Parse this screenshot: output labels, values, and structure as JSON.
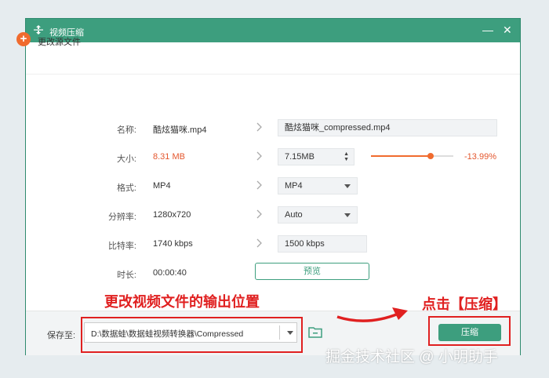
{
  "titlebar": {
    "title": "视频压缩",
    "minimize": "—",
    "close": "✕"
  },
  "toolbar": {
    "change_source_label": "更改源文件"
  },
  "labels": {
    "name": "名称:",
    "size": "大小:",
    "format": "格式:",
    "resolution": "分辨率:",
    "bitrate": "比特率:",
    "duration": "时长:"
  },
  "source": {
    "name": "酷炫猫咪.mp4",
    "size": "8.31 MB",
    "format": "MP4",
    "resolution": "1280x720",
    "bitrate": "1740 kbps",
    "duration": "00:00:40"
  },
  "output": {
    "name": "酷炫猫咪_compressed.mp4",
    "size": "7.15MB",
    "format": "MP4",
    "resolution": "Auto",
    "bitrate": "1500 kbps"
  },
  "slider": {
    "position_fraction": 0.72,
    "percent_label": "-13.99%"
  },
  "preview_label": "预览",
  "footer": {
    "save_to_label": "保存至:",
    "path": "D:\\数据蛙\\数据蛙视频转换器\\Compressed",
    "compress_label": "压缩"
  },
  "annotations": {
    "change_output": "更改视频文件的输出位置",
    "click_compress": "点击【压缩】"
  },
  "watermark": "掘金技术社区 @ 小明助手",
  "colors": {
    "accent": "#3d9e7e",
    "orange": "#f06b2e",
    "annotation_red": "#e02020"
  }
}
